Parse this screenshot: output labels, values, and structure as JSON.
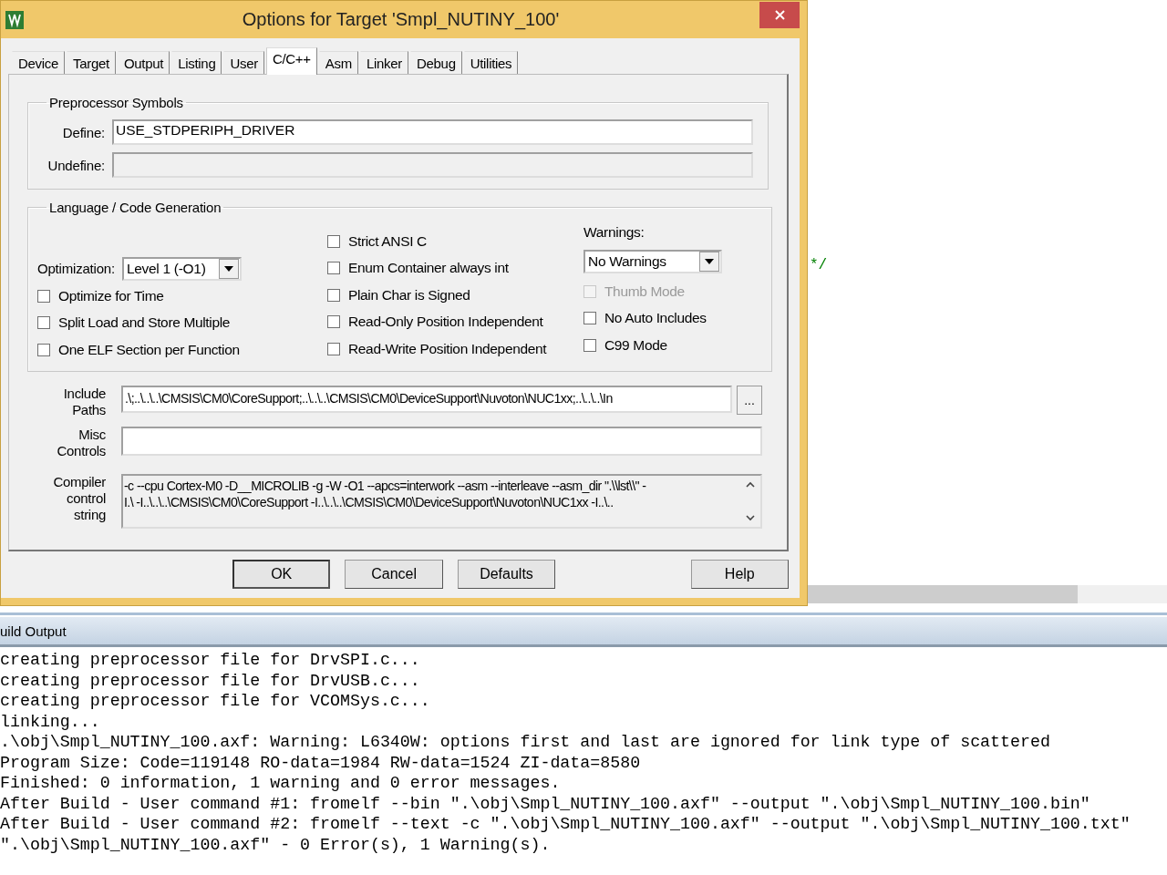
{
  "window": {
    "title": "Options for Target 'Smpl_NUTINY_100'"
  },
  "tabs": [
    {
      "label": "Device",
      "selected": false
    },
    {
      "label": "Target",
      "selected": false
    },
    {
      "label": "Output",
      "selected": false
    },
    {
      "label": "Listing",
      "selected": false
    },
    {
      "label": "User",
      "selected": false
    },
    {
      "label": "C/C++",
      "selected": true
    },
    {
      "label": "Asm",
      "selected": false
    },
    {
      "label": "Linker",
      "selected": false
    },
    {
      "label": "Debug",
      "selected": false
    },
    {
      "label": "Utilities",
      "selected": false
    }
  ],
  "preprocessor": {
    "title": "Preprocessor Symbols",
    "fields": [
      {
        "label": "Define:",
        "value": "USE_STDPERIPH_DRIVER",
        "disabled": false
      },
      {
        "label": "Undefine:",
        "disabled": true
      }
    ]
  },
  "code_generation": {
    "title": "Language / Code Generation",
    "optimization": {
      "label": "Optimization:",
      "value": "Level 1 (-O1)"
    },
    "left_options": [
      {
        "label": "Optimize for Time",
        "checked": false,
        "disabled": false
      },
      {
        "label": "Split Load and Store Multiple",
        "checked": false,
        "disabled": false
      },
      {
        "label": "One ELF Section per Function",
        "checked": false,
        "disabled": false
      }
    ],
    "middle_options": [
      {
        "label": "Strict ANSI C",
        "checked": false,
        "disabled": false
      },
      {
        "label": "Enum Container always int",
        "checked": false,
        "disabled": false
      },
      {
        "label": "Plain Char is Signed",
        "checked": false,
        "disabled": false
      },
      {
        "label": "Read-Only Position Independent",
        "checked": false,
        "disabled": false
      },
      {
        "label": "Read-Write Position Independent",
        "checked": false,
        "disabled": false
      }
    ],
    "warnings": {
      "label": "Warnings:",
      "value": "No Warnings"
    },
    "right_options": [
      {
        "label": "Thumb Mode",
        "checked": false,
        "disabled": true
      },
      {
        "label": "No Auto Includes",
        "checked": false,
        "disabled": false
      },
      {
        "label": "C99 Mode",
        "checked": false,
        "disabled": false
      }
    ]
  },
  "include_paths": {
    "label": "Include Paths",
    "value": ".\\;..\\..\\..\\CMSIS\\CM0\\CoreSupport;..\\..\\..\\CMSIS\\CM0\\DeviceSupport\\Nuvoton\\NUC1xx;..\\..\\..\\In",
    "browse": "..."
  },
  "misc_controls": {
    "label": "Misc Controls"
  },
  "compiler_control": {
    "label": "Compiler control string",
    "lines": [
      "-c --cpu Cortex-M0 -D__MICROLIB -g -W -O1 --apcs=interwork --asm --interleave --asm_dir \".\\\\lst\\\\\" -",
      "I.\\ -I..\\..\\..\\CMSIS\\CM0\\CoreSupport -I..\\..\\..\\CMSIS\\CM0\\DeviceSupport\\Nuvoton\\NUC1xx -I..\\.."
    ]
  },
  "buttons": [
    {
      "label": "OK",
      "default": true
    },
    {
      "label": "Cancel",
      "default": false
    },
    {
      "label": "Defaults",
      "default": false
    },
    {
      "label": "Help",
      "default": false
    }
  ],
  "editor": {
    "lines": [
      "*/"
    ]
  },
  "build_output": {
    "title": "uild Output",
    "lines": [
      "creating preprocessor file for DrvSPI.c...",
      "creating preprocessor file for DrvUSB.c...",
      "creating preprocessor file for VCOMSys.c...",
      "linking...",
      ".\\obj\\Smpl_NUTINY_100.axf: Warning: L6340W: options first and last are ignored for link type of scattered",
      "Program Size: Code=119148 RO-data=1984 RW-data=1524 ZI-data=8580",
      "Finished: 0 information, 1 warning and 0 error messages.",
      "After Build - User command #1: fromelf --bin \".\\obj\\Smpl_NUTINY_100.axf\" --output \".\\obj\\Smpl_NUTINY_100.bin\"",
      "After Build - User command #2: fromelf --text -c \".\\obj\\Smpl_NUTINY_100.axf\" --output \".\\obj\\Smpl_NUTINY_100.txt\"",
      "\".\\obj\\Smpl_NUTINY_100.axf\" - 0 Error(s), 1 Warning(s)."
    ]
  }
}
